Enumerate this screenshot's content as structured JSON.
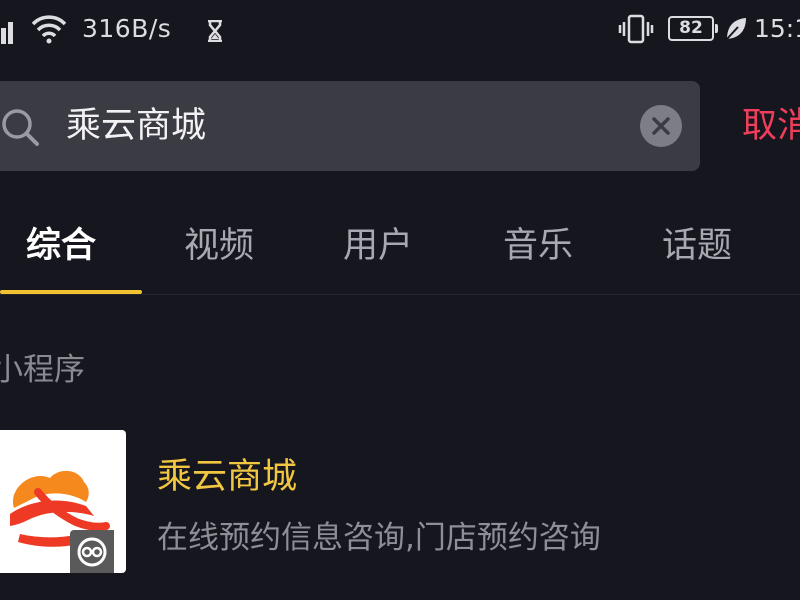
{
  "status_bar": {
    "network_speed": "316B/s",
    "battery_level": "82",
    "time": "15:1",
    "icons": [
      "signal-icon",
      "wifi-icon",
      "hourglass-icon",
      "vibrate-icon",
      "battery-icon",
      "leaf-icon"
    ]
  },
  "search": {
    "query": "乘云商城",
    "cancel_label": "取消"
  },
  "tabs": [
    {
      "label": "综合",
      "active": true
    },
    {
      "label": "视频",
      "active": false
    },
    {
      "label": "用户",
      "active": false
    },
    {
      "label": "音乐",
      "active": false
    },
    {
      "label": "话题",
      "active": false
    }
  ],
  "section": {
    "title": "小程序"
  },
  "results": [
    {
      "name": "乘云商城",
      "description": "在线预约信息咨询,门店预约咨询"
    }
  ],
  "colors": {
    "background": "#16161e",
    "accent_tab": "#f2c230",
    "cancel": "#ee3e5c",
    "result_title": "#f1c640"
  }
}
